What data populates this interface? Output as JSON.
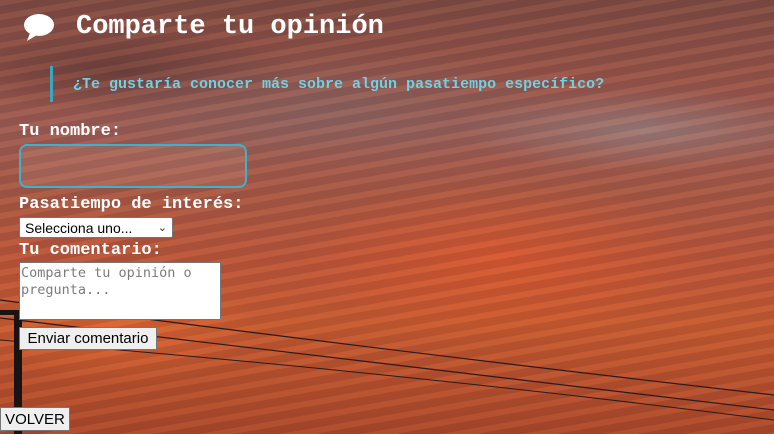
{
  "page": {
    "title": "Comparte tu opinión",
    "question": "¿Te gustaría conocer más sobre algún pasatiempo específico?"
  },
  "form": {
    "name_label": "Tu nombre:",
    "name_value": "",
    "hobby_label": "Pasatiempo de interés:",
    "hobby_selected": "Selecciona uno...",
    "comment_label": "Tu comentario:",
    "comment_placeholder": "Comparte tu opinión o pregunta...",
    "submit_label": "Enviar comentario"
  },
  "nav": {
    "back_label": "VOLVER"
  },
  "icons": {
    "title_icon": "speech-bubble-icon",
    "select_arrow": "chevron-down-icon"
  },
  "colors": {
    "accent": "#3ab3cf",
    "question_text": "#6fd0e6",
    "heading_text": "#ffffff"
  }
}
